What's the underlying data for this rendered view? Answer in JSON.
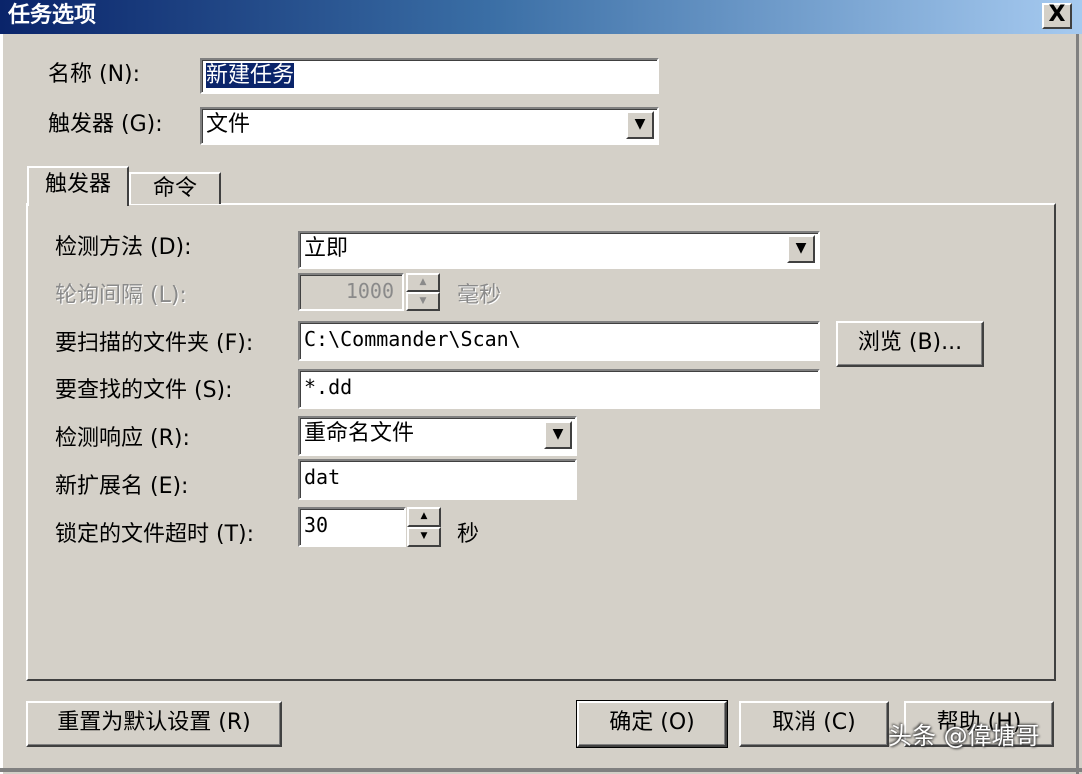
{
  "window": {
    "title": "任务选项",
    "close_glyph": "X"
  },
  "name": {
    "label": "名称 (N):",
    "value": "新建任务"
  },
  "trigger": {
    "label": "触发器 (G):",
    "value": "文件"
  },
  "tabs": [
    {
      "label": "触发器"
    },
    {
      "label": "命令"
    }
  ],
  "detect_method": {
    "label": "检测方法 (D):",
    "value": "立即"
  },
  "poll_interval": {
    "label": "轮询间隔 (L):",
    "value": "1000",
    "unit": "毫秒",
    "enabled": false
  },
  "scan_folder": {
    "label": "要扫描的文件夹 (F):",
    "value": "C:\\Commander\\Scan\\"
  },
  "browse_button": {
    "label": "浏览 (B)..."
  },
  "find_file": {
    "label": "要查找的文件 (S):",
    "value": "*.dd"
  },
  "detect_response": {
    "label": "检测响应 (R):",
    "value": "重命名文件"
  },
  "new_extension": {
    "label": "新扩展名 (E):",
    "value": "dat"
  },
  "lock_timeout": {
    "label": "锁定的文件超时 (T):",
    "value": "30",
    "unit": "秒"
  },
  "buttons": {
    "reset": "重置为默认设置 (R)",
    "ok": "确定 (O)",
    "cancel": "取消 (C)",
    "help": "帮助 (H)"
  },
  "watermark": "头条 @偉塘哥",
  "colors": {
    "titlebar_start": "#0a246a",
    "titlebar_end": "#a6caf0",
    "face": "#d4d0c8",
    "selection": "#0a246a"
  }
}
